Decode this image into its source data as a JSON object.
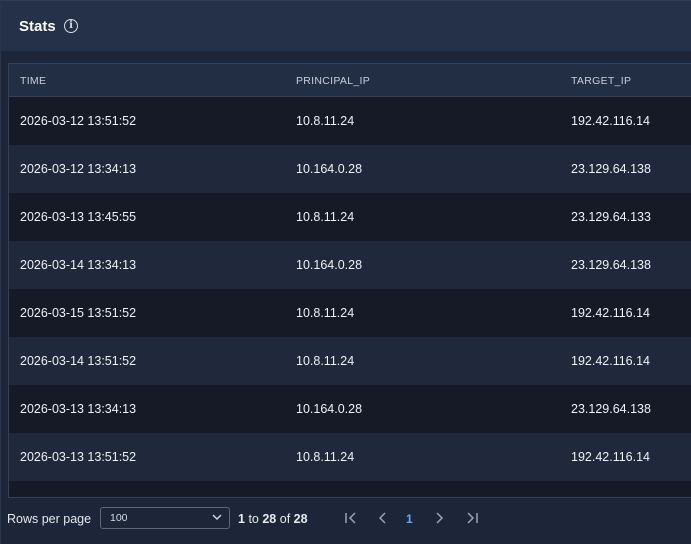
{
  "header": {
    "title": "Stats",
    "info_icon": "info-icon"
  },
  "table": {
    "columns": [
      "TIME",
      "PRINCIPAL_IP",
      "TARGET_IP"
    ],
    "rows": [
      {
        "time": "2026-03-12 13:51:52",
        "principal_ip": "10.8.11.24",
        "target_ip": "192.42.116.14"
      },
      {
        "time": "2026-03-12 13:34:13",
        "principal_ip": "10.164.0.28",
        "target_ip": "23.129.64.138"
      },
      {
        "time": "2026-03-13 13:45:55",
        "principal_ip": "10.8.11.24",
        "target_ip": "23.129.64.133"
      },
      {
        "time": "2026-03-14 13:34:13",
        "principal_ip": "10.164.0.28",
        "target_ip": "23.129.64.138"
      },
      {
        "time": "2026-03-15 13:51:52",
        "principal_ip": "10.8.11.24",
        "target_ip": "192.42.116.14"
      },
      {
        "time": "2026-03-14 13:51:52",
        "principal_ip": "10.8.11.24",
        "target_ip": "192.42.116.14"
      },
      {
        "time": "2026-03-13 13:34:13",
        "principal_ip": "10.164.0.28",
        "target_ip": "23.129.64.138"
      },
      {
        "time": "2026-03-13 13:51:52",
        "principal_ip": "10.8.11.24",
        "target_ip": "192.42.116.14"
      }
    ]
  },
  "pagination": {
    "rows_per_page_label": "Rows per page",
    "rows_per_page_value": "100",
    "range_start": "1",
    "range_to": "to",
    "range_end": "28",
    "range_of": "of",
    "total": "28",
    "current_page": "1"
  }
}
